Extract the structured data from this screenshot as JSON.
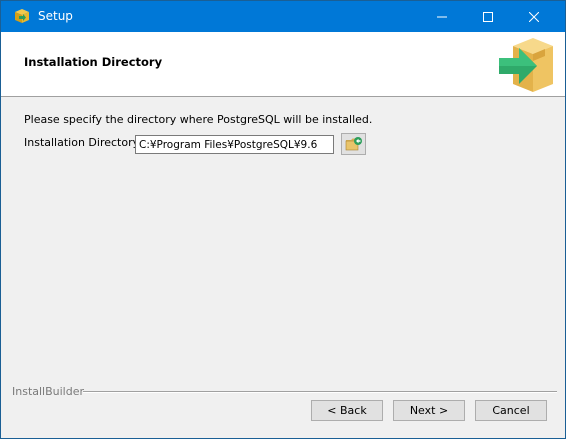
{
  "window": {
    "title": "Setup",
    "icon": "setup-app-icon",
    "controls": [
      "minimize-icon",
      "maximize-icon",
      "close-icon"
    ]
  },
  "header": {
    "title": "Installation Directory",
    "graphic": "box-arrow-icon"
  },
  "main": {
    "instruction": "Please specify the directory where PostgreSQL will be installed.",
    "directory_label": "Installation Directory",
    "directory_value": "C:¥Program Files¥PostgreSQL¥9.6",
    "browse_icon": "folder-browse-icon"
  },
  "footer": {
    "brand": "InstallBuilder",
    "back_label": "< Back",
    "next_label": "Next >",
    "cancel_label": "Cancel"
  },
  "colors": {
    "titlebar": "#0078d7",
    "desktop": "#1f6fa8",
    "dialog_background": "#f0f0f0"
  }
}
